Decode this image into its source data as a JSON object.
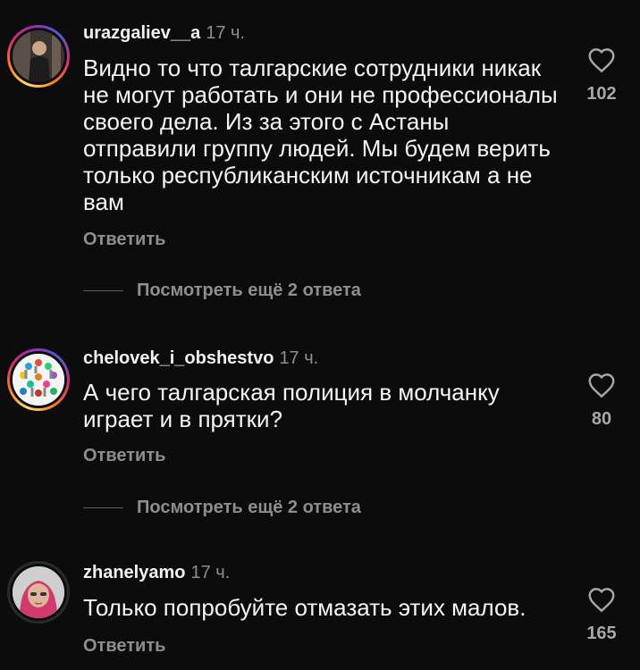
{
  "comments": [
    {
      "username": "urazgaliev__a",
      "time": "17 ч.",
      "text": "Видно то что талгарские сотрудники никак не могут работать и они не профессионалы своего дела. Из за этого с Астаны отправили группу людей. Мы будем верить только республиканским источникам а не вам",
      "reply_label": "Ответить",
      "view_replies": "Посмотреть ещё 2 ответа",
      "likes": "102"
    },
    {
      "username": "chelovek_i_obshestvo",
      "time": "17 ч.",
      "text": "А чего талгарская полиция в молчанку играет и в прятки?",
      "reply_label": "Ответить",
      "view_replies": "Посмотреть ещё 2 ответа",
      "likes": "80"
    },
    {
      "username": "zhanelyamo",
      "time": "17 ч.",
      "text": "Только попробуйте отмазать этих малов.",
      "reply_label": "Ответить",
      "likes": "165"
    }
  ],
  "icons": {
    "like": "heart-outline-icon"
  },
  "colors": {
    "background": "#0c0c0c",
    "text": "#f5f5f5",
    "muted": "#8e8e8e"
  }
}
